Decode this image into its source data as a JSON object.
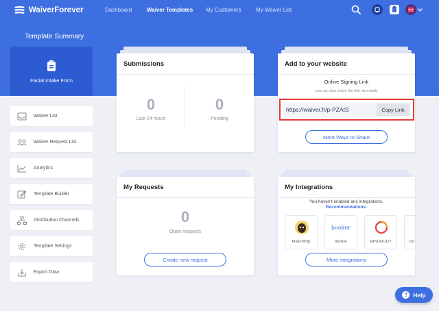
{
  "nav": {
    "brand": "WaiverForever",
    "links": [
      "Dashboard",
      "Waiver Templates",
      "My Customers",
      "My Waiver List"
    ],
    "active_index": 1
  },
  "page": {
    "section_title": "Template Summary",
    "current_template": "Facial Intake Form"
  },
  "sidebar": {
    "items": [
      {
        "label": "Waiver List",
        "icon": "inbox-icon"
      },
      {
        "label": "Waiver Request List",
        "icon": "users-icon"
      },
      {
        "label": "Analytics",
        "icon": "chart-icon"
      },
      {
        "label": "Template Builder",
        "icon": "edit-icon"
      },
      {
        "label": "Distribution Channels",
        "icon": "sitemap-icon"
      },
      {
        "label": "Template Settings",
        "icon": "gear-icon"
      },
      {
        "label": "Export Data",
        "icon": "download-icon"
      }
    ]
  },
  "submissions": {
    "title": "Submissions",
    "last24_value": "0",
    "last24_label": "Last 24 hours",
    "pending_value": "0",
    "pending_label": "Pending"
  },
  "website": {
    "title": "Add to your website",
    "subtitle": "Online Signing Link",
    "note": "you can also share the link via emails",
    "link": "https://waiver.fr/p-PZAtS",
    "copy_label": "Copy Link",
    "more_ways_label": "More Ways to Share"
  },
  "requests": {
    "title": "My Requests",
    "open_value": "0",
    "open_label": "Open requests",
    "create_label": "Create new request"
  },
  "integrations": {
    "title": "My Integrations",
    "note": "You haven't enabled any integrations.",
    "recommend_label": "Recommendations:",
    "items": [
      {
        "name": "Mailchimp",
        "icon": "mailchimp-icon"
      },
      {
        "name": "booker",
        "icon": "booker-icon",
        "logo_text": "booker"
      },
      {
        "name": "MINDBODY",
        "icon": "mindbody-icon"
      },
      {
        "name": "Go",
        "icon": "google-icon"
      }
    ],
    "more_label": "More integrations"
  },
  "help": {
    "label": "Help"
  },
  "colors": {
    "brand_blue": "#3d6fe0",
    "highlight_red": "#e53935"
  }
}
